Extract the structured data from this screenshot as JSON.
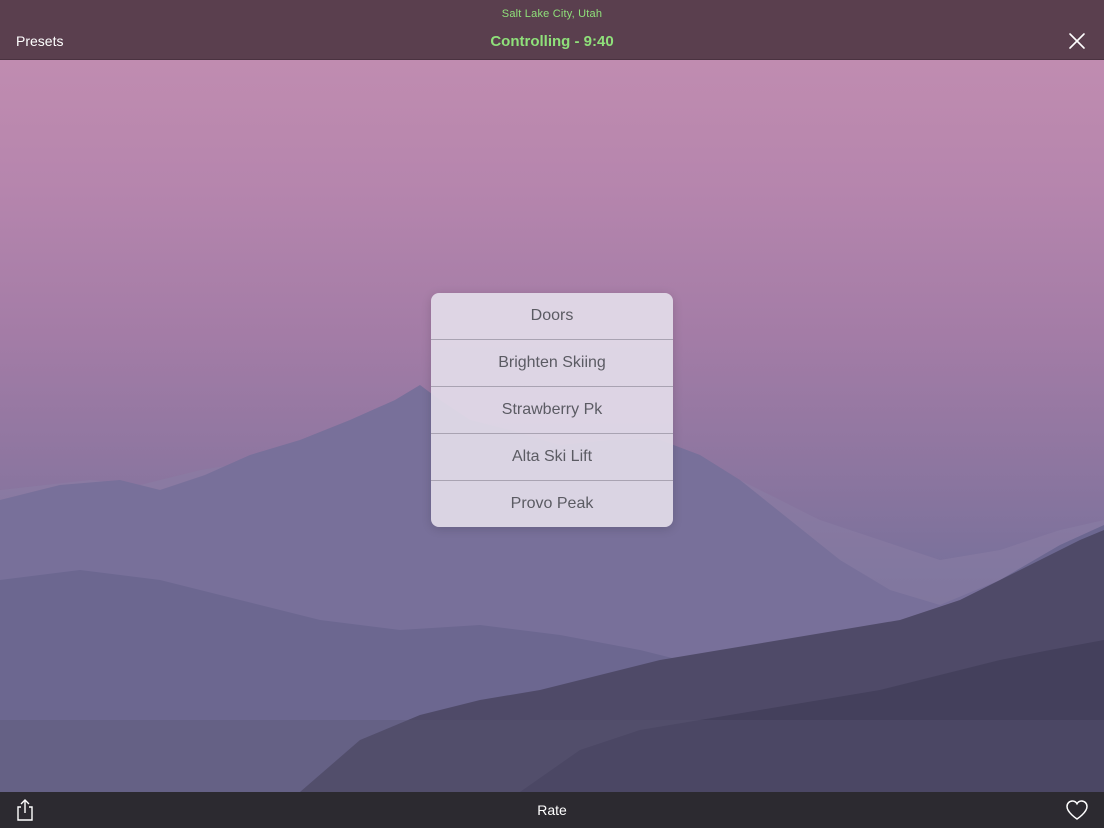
{
  "header": {
    "location": "Salt Lake City, Utah",
    "status": "Controlling - 9:40",
    "presets_label": "Presets",
    "close_icon": "close-icon"
  },
  "presets_menu": {
    "items": [
      {
        "label": "Doors"
      },
      {
        "label": "Brighten Skiing"
      },
      {
        "label": "Strawberry Pk"
      },
      {
        "label": "Alta Ski Lift"
      },
      {
        "label": "Provo Peak"
      }
    ]
  },
  "footer": {
    "share_icon": "share-icon",
    "rate_label": "Rate",
    "favorite_icon": "heart-icon"
  },
  "colors": {
    "accent_green": "#8fe07a",
    "topbar": "#5a3f4e",
    "bottombar": "#2c2a30"
  }
}
